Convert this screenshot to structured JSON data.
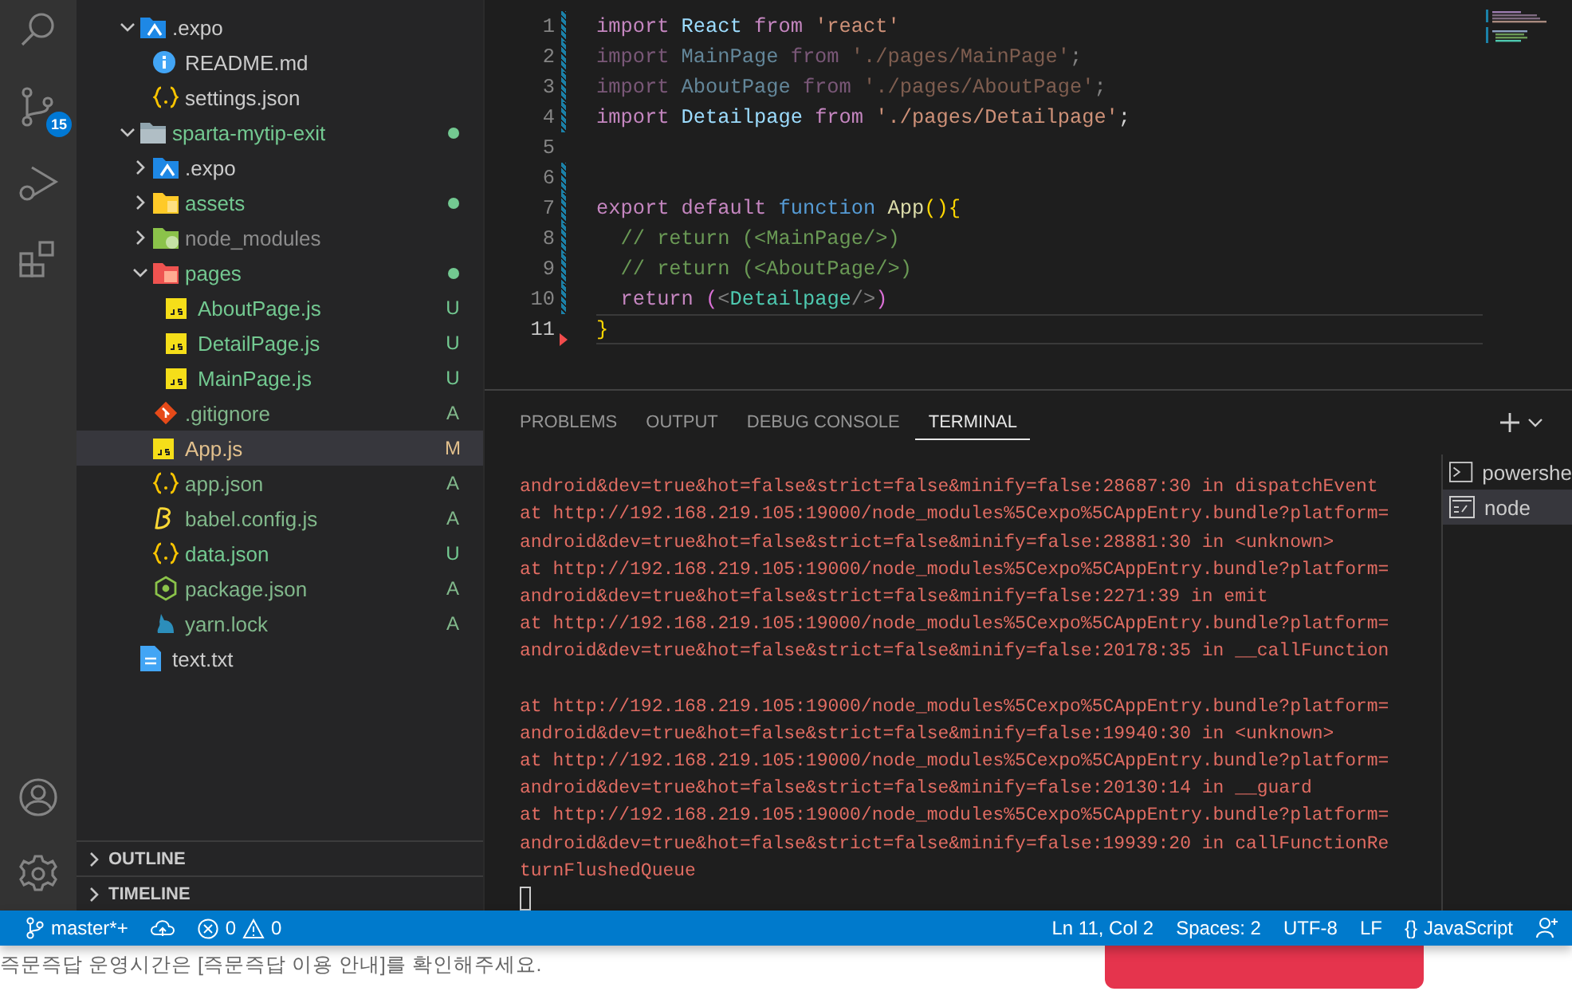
{
  "activity_bar": {
    "items": [
      {
        "kind": "search",
        "selected": false
      },
      {
        "kind": "source-control",
        "selected": false,
        "badge": "15"
      },
      {
        "kind": "run-debug",
        "selected": false
      },
      {
        "kind": "extensions",
        "selected": false
      }
    ],
    "bottom": [
      {
        "kind": "account"
      },
      {
        "kind": "settings"
      }
    ]
  },
  "explorer": {
    "tree": [
      {
        "name": ".expo",
        "kind": "expo",
        "expanded": true,
        "children": [
          {
            "name": "README.md",
            "kind": "info"
          },
          {
            "name": "settings.json",
            "kind": "json"
          }
        ]
      },
      {
        "name": "sparta-mytip-exit",
        "kind": "folder",
        "expanded": true,
        "color": "#73c991",
        "dot": true,
        "children": [
          {
            "name": ".expo",
            "kind": "expo",
            "expanded": false
          },
          {
            "name": "assets",
            "kind": "assets",
            "expanded": false,
            "color": "#73c991",
            "dot": true
          },
          {
            "name": "node_modules",
            "kind": "node",
            "expanded": false,
            "color": "#8c8c8c"
          },
          {
            "name": "pages",
            "kind": "pages",
            "expanded": true,
            "color": "#73c991",
            "dot": true,
            "children": [
              {
                "name": "AboutPage.js",
                "kind": "js",
                "color": "#73c991",
                "status": "U"
              },
              {
                "name": "DetailPage.js",
                "kind": "js",
                "color": "#73c991",
                "status": "U"
              },
              {
                "name": "MainPage.js",
                "kind": "js",
                "color": "#73c991",
                "status": "U"
              }
            ]
          },
          {
            "name": ".gitignore",
            "kind": "git",
            "color": "#81b88b",
            "status": "A"
          },
          {
            "name": "App.js",
            "kind": "js",
            "color": "#e2c08d",
            "status": "M",
            "selected": true
          },
          {
            "name": "app.json",
            "kind": "json",
            "color": "#81b88b",
            "status": "A"
          },
          {
            "name": "babel.config.js",
            "kind": "babel",
            "color": "#81b88b",
            "status": "A"
          },
          {
            "name": "data.json",
            "kind": "json",
            "color": "#73c991",
            "status": "U"
          },
          {
            "name": "package.json",
            "kind": "package",
            "color": "#81b88b",
            "status": "A"
          },
          {
            "name": "yarn.lock",
            "kind": "yarn",
            "color": "#81b88b",
            "status": "A"
          }
        ]
      },
      {
        "name": "text.txt",
        "kind": "txt"
      }
    ],
    "sections": [
      {
        "title": "OUTLINE",
        "expanded": false
      },
      {
        "title": "TIMELINE",
        "expanded": false
      }
    ]
  },
  "editor": {
    "lines": [
      {
        "number": "1",
        "modified": true,
        "deleted": false,
        "faded": false,
        "tokens": [
          {
            "kind": "keyword",
            "text": "import"
          },
          {
            "kind": "variable",
            "text": " React"
          },
          {
            "kind": "keyword",
            "text": " from"
          },
          {
            "kind": "string",
            "text": " 'react'"
          }
        ]
      },
      {
        "number": "2",
        "modified": true,
        "deleted": false,
        "faded": true,
        "tokens": [
          {
            "kind": "keyword",
            "text": "import"
          },
          {
            "kind": "variable",
            "text": " MainPage"
          },
          {
            "kind": "keyword",
            "text": " from"
          },
          {
            "kind": "string",
            "text": " './pages/MainPage'"
          },
          {
            "kind": "plain",
            "text": ";"
          }
        ]
      },
      {
        "number": "3",
        "modified": true,
        "deleted": false,
        "faded": true,
        "tokens": [
          {
            "kind": "keyword",
            "text": "import"
          },
          {
            "kind": "variable",
            "text": " AboutPage"
          },
          {
            "kind": "keyword",
            "text": " from"
          },
          {
            "kind": "string",
            "text": " './pages/AboutPage'"
          },
          {
            "kind": "plain",
            "text": ";"
          }
        ]
      },
      {
        "number": "4",
        "modified": true,
        "deleted": false,
        "faded": false,
        "tokens": [
          {
            "kind": "keyword",
            "text": "import"
          },
          {
            "kind": "variable",
            "text": " Detailpage"
          },
          {
            "kind": "keyword",
            "text": " from"
          },
          {
            "kind": "string",
            "text": " './pages/Detailpage'"
          },
          {
            "kind": "plain",
            "text": ";"
          }
        ]
      },
      {
        "number": "5",
        "modified": false,
        "deleted": false
      },
      {
        "number": "6",
        "modified": true,
        "deleted": false
      },
      {
        "number": "7",
        "modified": true,
        "deleted": false,
        "faded": false,
        "tokens": [
          {
            "kind": "keyword",
            "text": "export"
          },
          {
            "kind": "keyword",
            "text": " default"
          },
          {
            "kind": "storage",
            "text": " function"
          },
          {
            "kind": "function",
            "text": " App"
          },
          {
            "kind": "bracket",
            "text": "(){"
          }
        ]
      },
      {
        "number": "8",
        "modified": true,
        "deleted": false,
        "faded": false,
        "tokens": [
          {
            "kind": "comment",
            "text": "  // return (<MainPage/>)"
          }
        ]
      },
      {
        "number": "9",
        "modified": true,
        "deleted": false,
        "faded": false,
        "tokens": [
          {
            "kind": "comment",
            "text": "  // return (<AboutPage/>)"
          }
        ]
      },
      {
        "number": "10",
        "modified": true,
        "deleted": false,
        "faded": false,
        "tokens": [
          {
            "kind": "keyword",
            "text": "  return"
          },
          {
            "kind": "bracket2",
            "text": " ("
          },
          {
            "kind": "punct",
            "text": "<"
          },
          {
            "kind": "tag",
            "text": "Detailpage"
          },
          {
            "kind": "punct",
            "text": "/>"
          },
          {
            "kind": "bracket2",
            "text": ")"
          }
        ]
      },
      {
        "number": "11",
        "modified": false,
        "deleted": true,
        "faded": false,
        "current": true,
        "tokens": [
          {
            "kind": "bracket",
            "text": "}"
          }
        ]
      }
    ]
  },
  "panel": {
    "tabs": [
      {
        "label": "PROBLEMS",
        "selected": false
      },
      {
        "label": "OUTPUT",
        "selected": false
      },
      {
        "label": "DEBUG CONSOLE",
        "selected": false
      },
      {
        "label": "TERMINAL",
        "selected": true
      }
    ],
    "terminal_lines": [
      {
        "text": "android&dev=true&hot=false&strict=false&minify=false:28687:30 in dispatchEvent"
      },
      {
        "text": "at http://192.168.219.105:19000/node_modules%5Cexpo%5CAppEntry.bundle?platform="
      },
      {
        "text": "android&dev=true&hot=false&strict=false&minify=false:28881:30 in <unknown>"
      },
      {
        "text": "at http://192.168.219.105:19000/node_modules%5Cexpo%5CAppEntry.bundle?platform="
      },
      {
        "text": "android&dev=true&hot=false&strict=false&minify=false:2271:39 in emit"
      },
      {
        "text": "at http://192.168.219.105:19000/node_modules%5Cexpo%5CAppEntry.bundle?platform="
      },
      {
        "text": "android&dev=true&hot=false&strict=false&minify=false:20178:35 in __callFunction"
      },
      {
        "text": "at http://192.168.219.105:19000/node_modules%5Cexpo%5CAppEntry.bundle?platform=",
        "gap_before": true
      },
      {
        "text": "android&dev=true&hot=false&strict=false&minify=false:19940:30 in <unknown>"
      },
      {
        "text": "at http://192.168.219.105:19000/node_modules%5Cexpo%5CAppEntry.bundle?platform="
      },
      {
        "text": "android&dev=true&hot=false&strict=false&minify=false:20130:14 in __guard"
      },
      {
        "text": "at http://192.168.219.105:19000/node_modules%5Cexpo%5CAppEntry.bundle?platform="
      },
      {
        "text": "android&dev=true&hot=false&strict=false&minify=false:19939:20 in callFunctionRe"
      },
      {
        "text": "turnFlushedQueue"
      }
    ],
    "sessions": [
      {
        "name": "powershe",
        "kind": "powershell",
        "selected": false
      },
      {
        "name": "node",
        "kind": "cmd",
        "selected": true
      }
    ]
  },
  "status_bar": {
    "branch": "master*+",
    "errors": "0",
    "warnings": "0",
    "right": [
      {
        "kind": "text",
        "text": "Ln 11, Col 2"
      },
      {
        "kind": "text",
        "text": "Spaces: 2"
      },
      {
        "kind": "text",
        "text": "UTF-8"
      },
      {
        "kind": "text",
        "text": "LF"
      },
      {
        "kind": "language",
        "icon": "{}",
        "text": "JavaScript"
      }
    ]
  },
  "page_below": {
    "notice": "즉문즉답 운영시간은 [즉문즉답 이용 안내]를 확인해주세요."
  }
}
